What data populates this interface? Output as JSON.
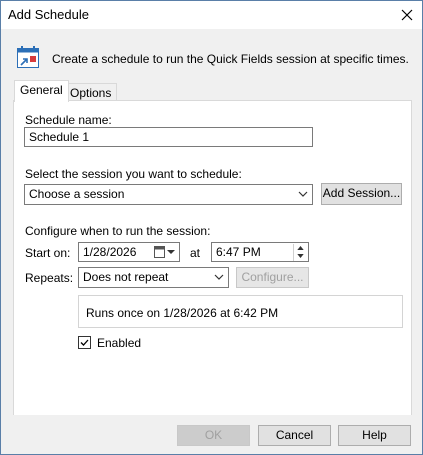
{
  "window": {
    "title": "Add Schedule"
  },
  "header": {
    "text": "Create a schedule to run the Quick Fields session at specific times."
  },
  "tabs": [
    {
      "label": "General",
      "active": true
    },
    {
      "label": "Options",
      "active": false
    }
  ],
  "general": {
    "schedule_name_label": "Schedule name:",
    "schedule_name_value": "Schedule 1",
    "session_label": "Select the session you want to schedule:",
    "session_value": "Choose a session",
    "add_session_label": "Add Session...",
    "configure_label": "Configure when to run the session:",
    "start_on_label": "Start on:",
    "start_date": "1/28/2026",
    "at_label": "at",
    "start_time": "6:47 PM",
    "repeats_label": "Repeats:",
    "repeats_value": "Does not repeat",
    "configure_button": "Configure...",
    "summary": "Runs once on 1/28/2026 at 6:42 PM",
    "enabled_label": "Enabled",
    "enabled_checked": true
  },
  "footer": {
    "ok": "OK",
    "cancel": "Cancel",
    "help": "Help"
  },
  "icons": {
    "close": "close-icon",
    "header": "schedule-calendar-icon",
    "date_picker": "calendar-dropdown-icon"
  }
}
